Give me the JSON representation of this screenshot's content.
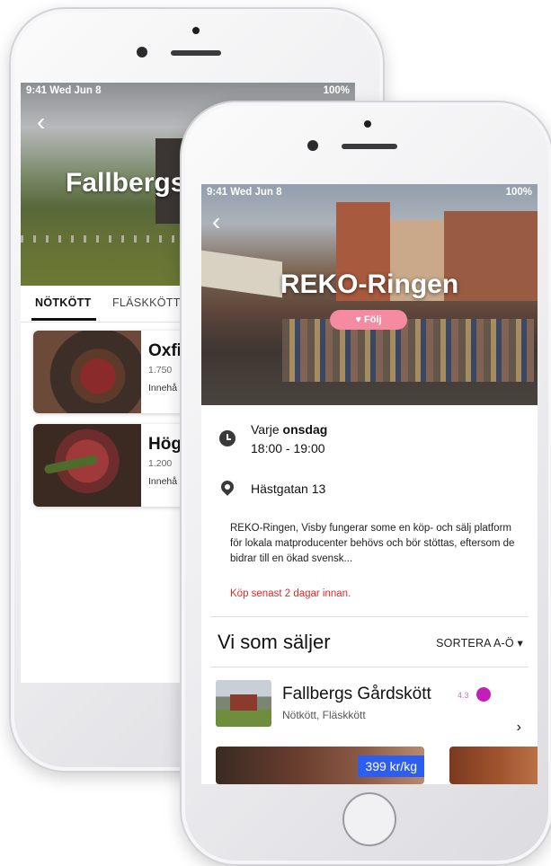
{
  "back_screen": {
    "status": {
      "time": "9:41 Wed Jun 8",
      "right": "100%"
    },
    "title": "Fallbergs",
    "tabs": [
      {
        "label": "NÖTKÖTT",
        "active": true
      },
      {
        "label": "FLÄSKKÖTT",
        "active": false
      }
    ],
    "cards": [
      {
        "title": "Oxfil",
        "sub": "1.750",
        "sub2": "Innehå"
      },
      {
        "title": "Hög",
        "sub": "1.200",
        "sub2": "Innehå"
      }
    ]
  },
  "front_screen": {
    "status": {
      "time": "9:41 Wed Jun 8",
      "right": "100%"
    },
    "title": "REKO-Ringen",
    "follow_label": "♥ Följ",
    "schedule": {
      "prefix": "Varje ",
      "day": "onsdag",
      "time": "18:00 - 19:00"
    },
    "address": "Hästgatan 13",
    "description": "REKO-Ringen, Visby fungerar some en köp- och sälj platform för lokala matproducenter behövs och bör stöttas, eftersom de bidrar till en ökad svensk...",
    "warning": "Köp senast 2 dagar innan.",
    "sellers_heading": "Vi som säljer",
    "sort_label": "SORTERA A-Ö ▾",
    "seller": {
      "name": "Fallbergs Gårdskött",
      "rating": "4.3",
      "categories": "Nötkött, Fläskkött"
    },
    "product_price": "399 kr/kg"
  },
  "colors": {
    "accent_pink": "#f58aa0",
    "warning_red": "#e02a2a",
    "price_blue": "#2d5ef0",
    "badge_magenta": "#c21fb8"
  }
}
